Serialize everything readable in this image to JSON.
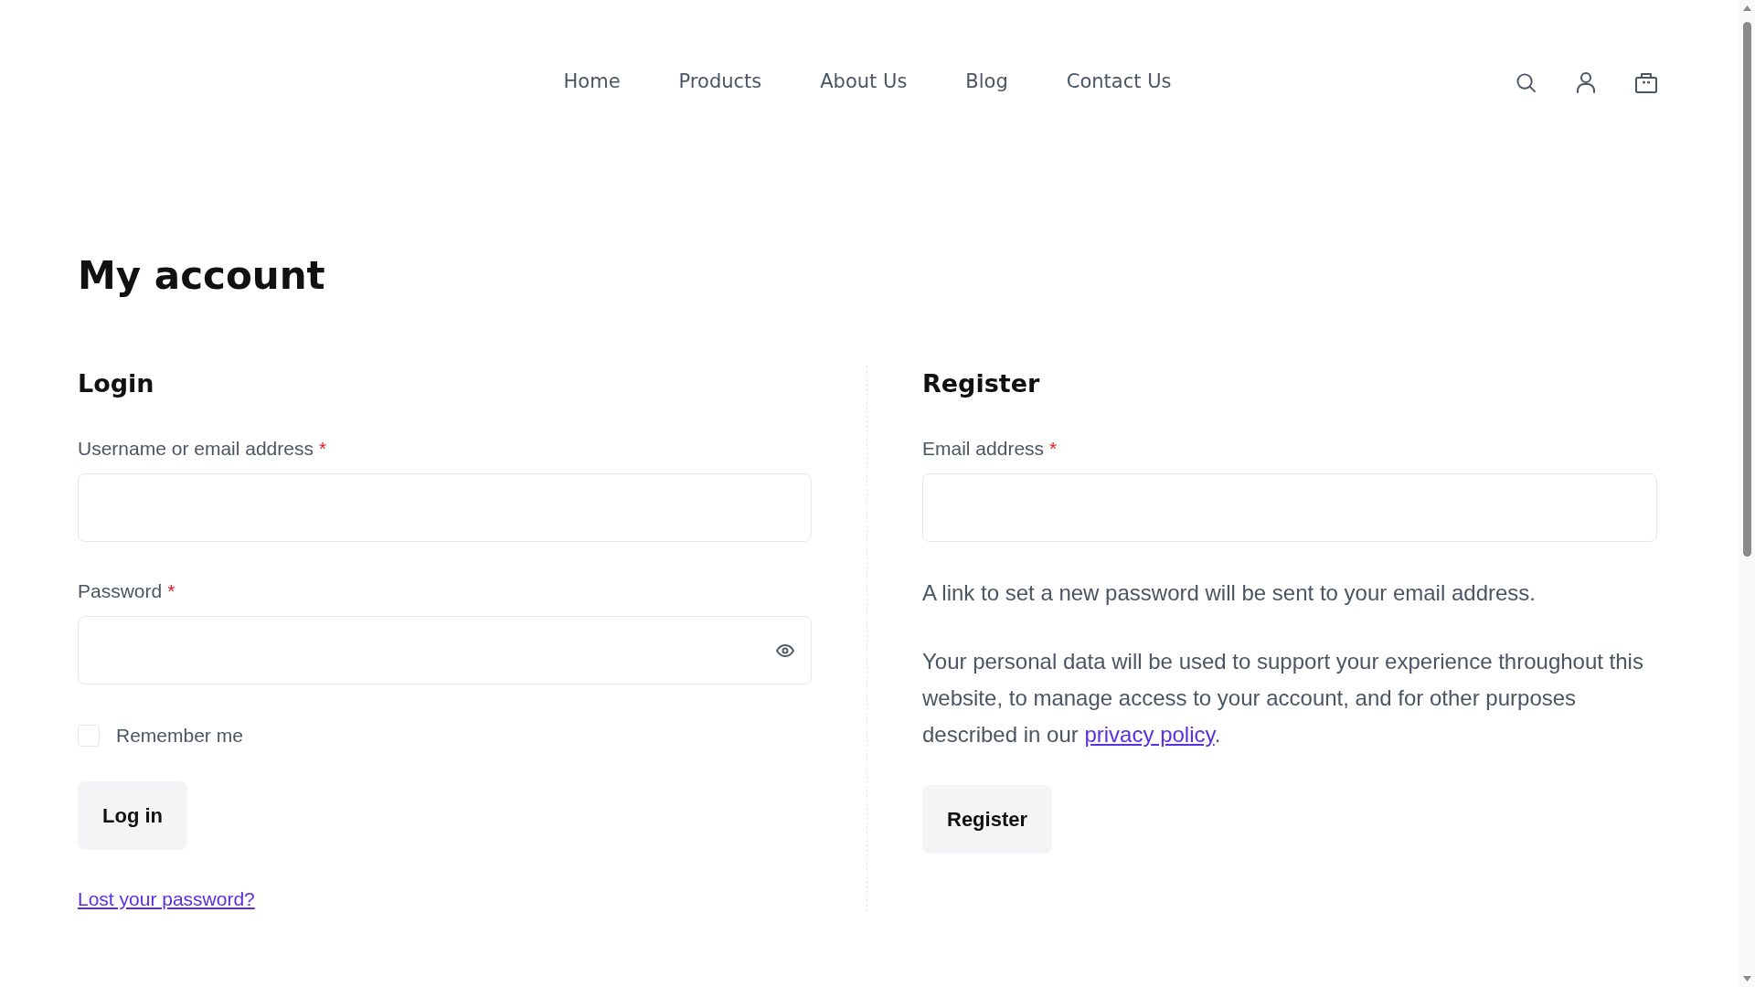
{
  "nav": {
    "links": [
      "Home",
      "Products",
      "About Us",
      "Blog",
      "Contact Us"
    ]
  },
  "page_title": "My account",
  "login": {
    "title": "Login",
    "fields": [
      {
        "kind": "text",
        "label": "Username or email address",
        "required_mark": "*"
      },
      {
        "kind": "password",
        "label": "Password",
        "required_mark": "*"
      }
    ],
    "remember": {
      "label": "Remember me",
      "checked": false
    },
    "button": "Log in",
    "lost_password_link": "Lost your password?"
  },
  "register": {
    "title": "Register",
    "fields": [
      {
        "kind": "text",
        "label": "Email address",
        "required_mark": "*"
      }
    ],
    "notes": [
      {
        "text": "A link to set a new password will be sent to your email address."
      },
      {
        "text": "Your personal data will be used to support your experience throughout this website, to manage access to your account, and for other purposes described in our ",
        "link": "privacy policy",
        "after": "."
      }
    ],
    "button": "Register"
  }
}
